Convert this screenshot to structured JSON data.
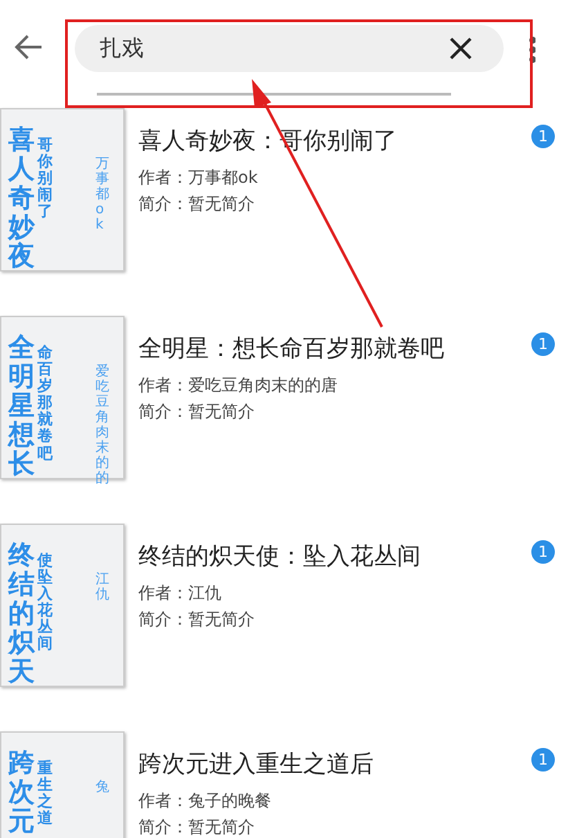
{
  "search": {
    "value": "扎戏"
  },
  "books": [
    {
      "title": "喜人奇妙夜：哥你别闹了",
      "author": "作者：万事都ok",
      "intro": "简介：暂无简介",
      "badge": "1",
      "cover": {
        "main": "喜人奇妙夜",
        "sub": "哥你别闹了",
        "author": "万事都ok"
      }
    },
    {
      "title": "全明星：想长命百岁那就卷吧",
      "author": "作者：爱吃豆角肉末的的唐",
      "intro": "简介：暂无简介",
      "badge": "1",
      "cover": {
        "main": "全明星想长",
        "sub": "命百岁那就卷吧",
        "author": "爱吃豆角肉末的的"
      }
    },
    {
      "title": "终结的炽天使：坠入花丛间",
      "author": "作者：江仇",
      "intro": "简介：暂无简介",
      "badge": "1",
      "cover": {
        "main": "终结的炽天",
        "sub": "使坠入花丛间",
        "author": "江仇"
      }
    },
    {
      "title": "跨次元进入重生之道后",
      "author": "作者：兔子的晚餐",
      "intro": "简介：暂无简介",
      "badge": "1",
      "cover": {
        "main": "跨次元",
        "sub": "重生之道",
        "author": "兔"
      }
    }
  ]
}
